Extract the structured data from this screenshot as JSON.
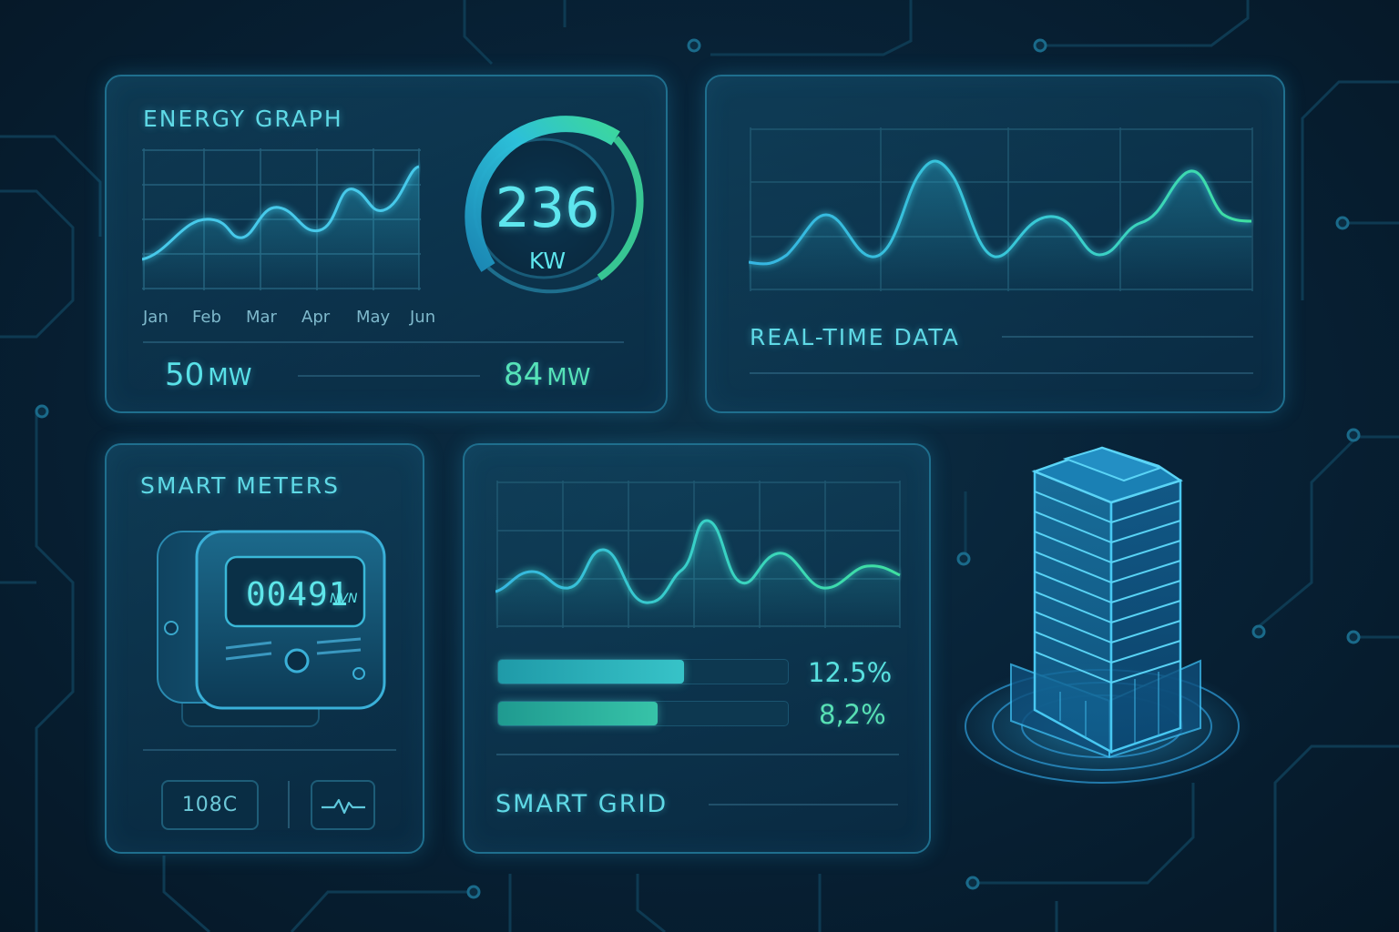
{
  "energy_graph": {
    "title": "ENERGY GRAPH",
    "months": [
      "Jan",
      "Feb",
      "Mar",
      "Apr",
      "May",
      "Jun"
    ],
    "gauge": {
      "value": "236",
      "unit": "KW"
    },
    "stats": [
      {
        "value": "50",
        "unit": "MW"
      },
      {
        "value": "84",
        "unit": "MW"
      }
    ]
  },
  "realtime": {
    "title": "REAL-TIME DATA"
  },
  "smart_meters": {
    "title": "SMART METERS",
    "display_value": "00491",
    "display_unit": "NVN",
    "chip_label": "108C",
    "pulse_icon": "pulse-wave-icon"
  },
  "smart_grid": {
    "title": "SMART GRID",
    "bars": [
      {
        "label": "12.5%",
        "fraction": 0.64
      },
      {
        "label": "8,2%",
        "fraction": 0.55
      }
    ]
  },
  "building": {
    "icon": "skyscraper-hologram-icon"
  },
  "colors": {
    "accent_cyan": "#38c8e8",
    "accent_green": "#3fe0a0",
    "panel_border": "#1f6f8e",
    "background": "#061b2c"
  }
}
